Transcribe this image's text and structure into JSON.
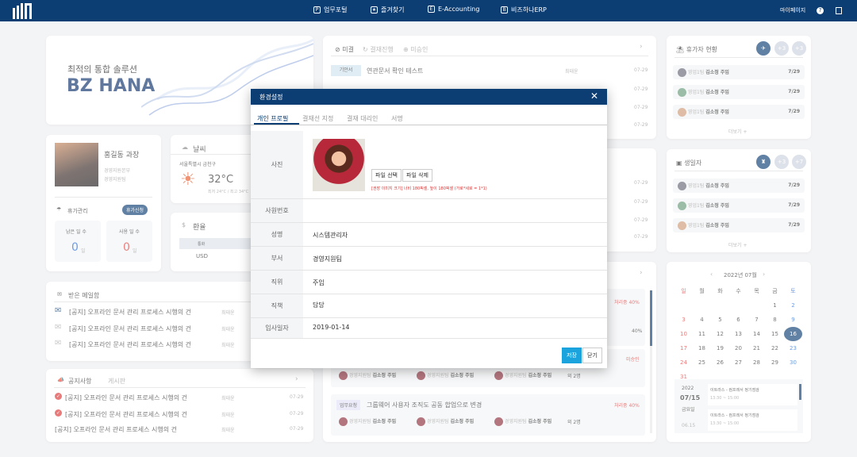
{
  "nav": {
    "items": [
      {
        "icon": "P",
        "label": "업무포털"
      },
      {
        "icon": "★",
        "label": "즐겨찾기"
      },
      {
        "icon": "E",
        "label": "E-Accounting"
      },
      {
        "icon": "B",
        "label": "비즈하나ERP"
      }
    ],
    "mypage": "마이페이지"
  },
  "banner": {
    "subtitle": "최적의 통합 솔루션",
    "title": "BZ HANA"
  },
  "profile": {
    "name": "홍길동 과장",
    "dept1": "경영지원본부",
    "dept2": "경영지원팀",
    "leave_title": "휴가관리",
    "leave_btn": "휴가신청",
    "remaining_label": "남은 일 수",
    "used_label": "사용 일 수",
    "remaining": "0",
    "used": "0",
    "unit": "일"
  },
  "weather": {
    "title": "날씨",
    "location": "서울특별시 금천구",
    "temp": "32°C",
    "range": "최저 24°C / 최고 34°C"
  },
  "exchange": {
    "title": "환율",
    "col": "통화",
    "row": "USD"
  },
  "mail": {
    "title": "받은 메일함",
    "items": [
      {
        "text": "[공지] 오프라인 문서 관리 프로세스 시행의 건",
        "who": "최태윤"
      },
      {
        "text": "[공지] 오프라인 문서 관리 프로세스 시행의 건",
        "who": "최태윤"
      },
      {
        "text": "[공지] 오프라인 문서 관리 프로세스 시행의 건",
        "who": "최태윤"
      }
    ]
  },
  "notice": {
    "tab1": "공지사항",
    "tab2": "게시판",
    "items": [
      {
        "text": "[공지] 오프라인 문서 관리 프로세스 시행의 건",
        "who": "최태윤",
        "date": "07-29"
      },
      {
        "text": "[공지] 오프라인 문서 관리 프로세스 시행의 건",
        "who": "최태윤",
        "date": "07-29"
      },
      {
        "text": "[공지] 오프라인 문서 관리 프로세스 시행의 건",
        "who": "최태윤",
        "date": "07-29"
      }
    ]
  },
  "approval": {
    "tabs": [
      "미결",
      "결재진행",
      "미승인"
    ],
    "items": [
      {
        "tag": "기안서",
        "text": "연관문서 확인 테스트",
        "who": "최태윤",
        "date": "07-29"
      }
    ],
    "dates": [
      "07-29",
      "07-29",
      "07-29",
      "07-29"
    ],
    "dates2": [
      "07-29",
      "07-29",
      "07-29",
      "07-29",
      "07-29"
    ]
  },
  "tasks": {
    "status1": "처리중 40%",
    "pct": "40%",
    "status2": "미승인",
    "people": [
      {
        "team": "경영지원팀",
        "name": "김소정 주임"
      },
      {
        "team": "경영지원팀",
        "name": "김소정 주임"
      },
      {
        "team": "경영지원팀",
        "name": "김소정 주임"
      }
    ],
    "more": "외 2명",
    "tag2": "업무요청",
    "task2": "그룹웨어 사용자 조직도 공동 합업으로 변경",
    "status3": "처리중 40%"
  },
  "vacation": {
    "title": "휴가자 현황",
    "badges": [
      "+3",
      "+3"
    ],
    "items": [
      {
        "team": "영업1팀",
        "name": "김소정 주임",
        "date": "7/29"
      },
      {
        "team": "영업1팀",
        "name": "김소정 주임",
        "date": "7/29"
      },
      {
        "team": "영업1팀",
        "name": "김소정 주임",
        "date": "7/29"
      }
    ],
    "more": "더보기 +"
  },
  "birthday": {
    "title": "생일자",
    "badges": [
      "+3",
      "+7"
    ],
    "items": [
      {
        "team": "영업1팀",
        "name": "김소정 주임",
        "date": "7/29"
      },
      {
        "team": "영업1팀",
        "name": "김소정 주임",
        "date": "7/29"
      },
      {
        "team": "영업1팀",
        "name": "김소정 주임",
        "date": "7/29"
      }
    ],
    "more": "더보기 +"
  },
  "calendar": {
    "month": "2022년 07월",
    "days": [
      "일",
      "월",
      "화",
      "수",
      "목",
      "금",
      "토"
    ],
    "weeks": [
      [
        "",
        "",
        "",
        "",
        "",
        "1",
        "2"
      ],
      [
        "3",
        "4",
        "5",
        "6",
        "7",
        "8",
        "9"
      ],
      [
        "10",
        "11",
        "12",
        "13",
        "14",
        "15",
        "16"
      ],
      [
        "17",
        "18",
        "19",
        "20",
        "21",
        "22",
        "23"
      ],
      [
        "24",
        "25",
        "26",
        "27",
        "28",
        "29",
        "30"
      ],
      [
        "31",
        "",
        "",
        "",
        "",
        "",
        ""
      ]
    ],
    "year": "2022",
    "date": "07/15",
    "weekday": "금요일",
    "date2": "06.15",
    "events": [
      {
        "title": "이트라스 - 컴프레서 정기점검",
        "time": "13:30 ~ 15:00"
      },
      {
        "title": "이트라스 - 컴프레서 정기점검",
        "time": "13:30 ~ 15:00"
      }
    ]
  },
  "modal": {
    "title": "환경설정",
    "tabs": [
      "개인 프로필",
      "결재선 지정",
      "결재 대리인",
      "서명"
    ],
    "photo_label": "사진",
    "file_select": "파일 선택",
    "file_delete": "파일 삭제",
    "hint": "[권장 이미지 크기] 너비 180픽셀, 높이 180픽셀 (가로*세로 = 1*1)",
    "fields": [
      {
        "label": "사원번호",
        "value": ""
      },
      {
        "label": "성명",
        "value": "시스템관리자"
      },
      {
        "label": "부서",
        "value": "경영지원팀"
      },
      {
        "label": "직위",
        "value": "주임"
      },
      {
        "label": "직책",
        "value": "담당"
      },
      {
        "label": "입사일자",
        "value": "2019-01-14"
      }
    ],
    "save": "저장",
    "close": "닫기"
  }
}
